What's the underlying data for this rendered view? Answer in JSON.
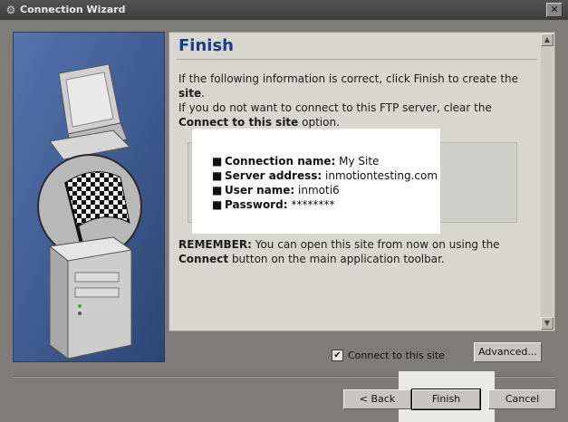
{
  "window": {
    "title": "Connection Wizard",
    "close_glyph": "✕"
  },
  "page": {
    "heading": "Finish",
    "intro_line1_pre": "If the following information is correct, click Finish to create the ",
    "intro_line1_bold": "site",
    "intro_line1_post": ".",
    "intro_line2_pre": "If you do not want to connect to this FTP server, clear the ",
    "intro_line2_bold": "Connect to this site",
    "intro_line2_post": " option."
  },
  "summary": [
    {
      "label": "Connection name:",
      "value": "My Site"
    },
    {
      "label": "Server address:",
      "value": "inmotiontesting.com"
    },
    {
      "label": "User name:",
      "value": "inmoti6"
    },
    {
      "label": "Password:",
      "value": "********"
    }
  ],
  "remember": {
    "bold1": "REMEMBER:",
    "text1": " You can open this site from now on using the",
    "bold2": "Connect",
    "text2": " button on the main application toolbar."
  },
  "options": {
    "connect_checked": true,
    "connect_label": "Connect to this site",
    "check_glyph": "✔"
  },
  "buttons": {
    "advanced": "Advanced...",
    "back": "< Back",
    "finish": "Finish",
    "cancel": "Cancel"
  },
  "icons": {
    "app": "ftp-wizard-icon",
    "illustration": "computers-checkered-flag-icon"
  },
  "colors": {
    "heading": "#1c3d8a",
    "side_panel": "#3d5a8e"
  }
}
